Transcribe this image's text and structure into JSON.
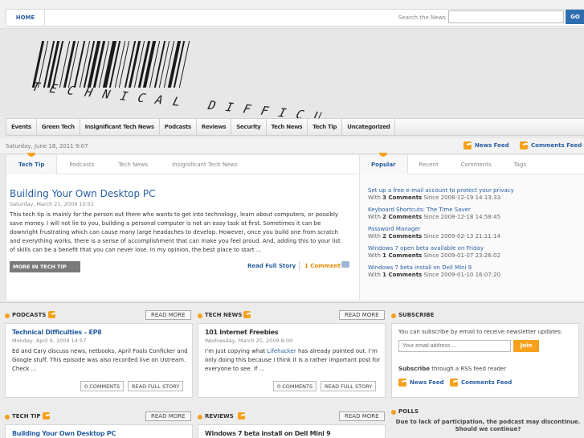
{
  "topbar": {
    "home": "HOME",
    "search_label": "Search the News",
    "go": "GO"
  },
  "header": {
    "logo_text": "TECHNICAL DIFFICULTIES"
  },
  "nav": [
    "Events",
    "Green Tech",
    "Insignificant Tech News",
    "Podcasts",
    "Reviews",
    "Security",
    "Tech News",
    "Tech Tip",
    "Uncategorized"
  ],
  "datebar": {
    "date": "Saturday, June 18, 2011 9:07",
    "news_feed": "News Feed",
    "comments_feed": "Comments Feed"
  },
  "main_tabs": [
    "Tech Tip",
    "Podcasts",
    "Tech News",
    "Insignificant Tech News"
  ],
  "feature": {
    "title": "Building Your Own Desktop PC",
    "date": "Saturday, March 21, 2009 10:51",
    "body": "This tech tip is mainly for the person out there who wants to get into technology, learn about computers, or possibly save money. I will not lie to you, building a personal computer is not an easy task at first. Sometimes it can be downright frustrating which can cause many large headaches to develop. However, once you build one from scratch and everything works, there is a sense of accomplishment that can make you feel proud. And, adding this to your list of skills can be a benefit that you can never lose. In my opinion, the best place to start ...",
    "more_button": "MORE IN TECH TIP",
    "read_full": "Read Full Story",
    "comments": "1 Comment"
  },
  "side_tabs": [
    "Popular",
    "Recent",
    "Comments",
    "Tags"
  ],
  "popular": [
    {
      "title": "Set up a free e-mail account to protect your privacy",
      "with": "With",
      "count": "3 Comments",
      "since": "Since 2008-12-19 14:13:33"
    },
    {
      "title": "Keyboard Shortcuts: The Time Saver",
      "with": "With",
      "count": "2 Comments",
      "since": "Since 2008-12-18 14:58:45"
    },
    {
      "title": "Password Manager",
      "with": "With",
      "count": "2 Comments",
      "since": "Since 2009-02-13 21:11:14"
    },
    {
      "title": "Windows 7 open beta available on Friday",
      "with": "With",
      "count": "1 Comments",
      "since": "Since 2009-01-07 23:26:02"
    },
    {
      "title": "Windows 7 beta install on Dell Mini 9",
      "with": "With",
      "count": "1 Comments",
      "since": "Since 2009-01-10 16:07:20"
    }
  ],
  "podcasts": {
    "heading": "PODCASTS",
    "read_more": "READ MORE",
    "title": "Technical Difficulties – EP8",
    "date": "Monday, April 6, 2009 14:57",
    "body": "Ed and Cary discuss news, netbooks, April Fools Conficker and Google stuff. This episode was also recorded live on Ustream. Check ...",
    "comments_btn": "0 COMMENTS",
    "read_full_btn": "READ FULL STORY"
  },
  "technews": {
    "heading": "TECH NEWS",
    "read_more": "READ MORE",
    "title": "101 Internet Freebies",
    "date": "Wednesday, March 25, 2009 8:00",
    "body_pre": "I’m just copying what ",
    "body_link": "Lifehacker",
    "body_post": " has already pointed out. I’m only doing this because I think it is a rather important post for everyone to see. If ...",
    "comments_btn": "0 COMMENTS",
    "read_full_btn": "READ FULL STORY"
  },
  "subscribe": {
    "heading": "SUBSCRIBE",
    "text": "You can subscribe by email to receive newsletter updates:",
    "email_placeholder": "Your email address ...",
    "join": "Join",
    "rss_pre": "Subscribe",
    "rss_post": " through a RSS feed reader",
    "news_feed": "News Feed",
    "comments_feed": "Comments Feed"
  },
  "techtip": {
    "heading": "TECH TIP",
    "read_more": "READ MORE",
    "title": "Building Your Own Desktop PC"
  },
  "reviews": {
    "heading": "REVIEWS",
    "read_more": "READ MORE",
    "title": "Windows 7 beta install on Dell Mini 9"
  },
  "polls": {
    "heading": "POLLS",
    "text": "Due to lack of participation, the podcast may discontinue. Should we continue?"
  },
  "colors": {
    "accent": "#2a5fa3",
    "orange": "#f5a11d"
  }
}
